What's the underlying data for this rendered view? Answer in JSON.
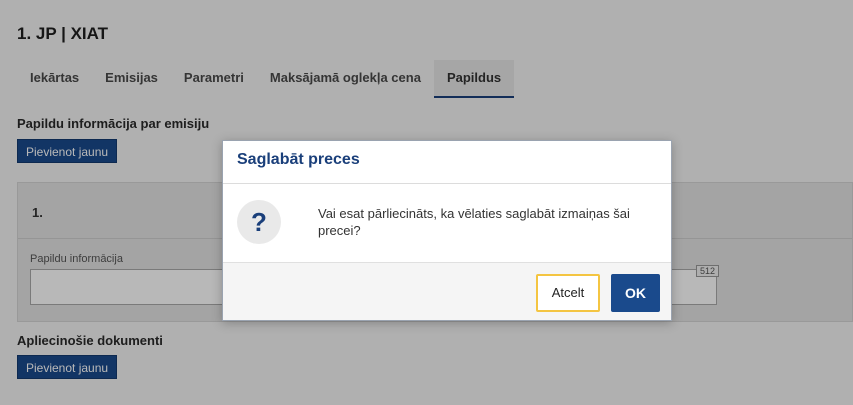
{
  "page": {
    "title": "1. JP | XIAT",
    "tabs": [
      {
        "label": "Iekārtas"
      },
      {
        "label": "Emisijas"
      },
      {
        "label": "Parametri"
      },
      {
        "label": "Maksājamā oglekļa cena"
      },
      {
        "label": "Papildus"
      }
    ],
    "active_tab": "Papildus"
  },
  "emission_section": {
    "heading": "Papildu informācija par emisiju",
    "add_button": "Pievienot jaunu",
    "item": {
      "number": "1.",
      "field_label": "Papildu informācija",
      "field_value": "",
      "char_limit": "512"
    }
  },
  "documents_section": {
    "heading": "Apliecinošie dokumenti",
    "add_button": "Pievienot jaunu"
  },
  "modal": {
    "title": "Saglabāt preces",
    "icon_glyph": "?",
    "message": "Vai esat pārliecināts, ka vēlaties saglabāt izmaiņas šai precei?",
    "cancel_label": "Atcelt",
    "ok_label": "OK"
  },
  "colors": {
    "accent": "#1a4a8c",
    "focus_outline": "#f4c542"
  }
}
